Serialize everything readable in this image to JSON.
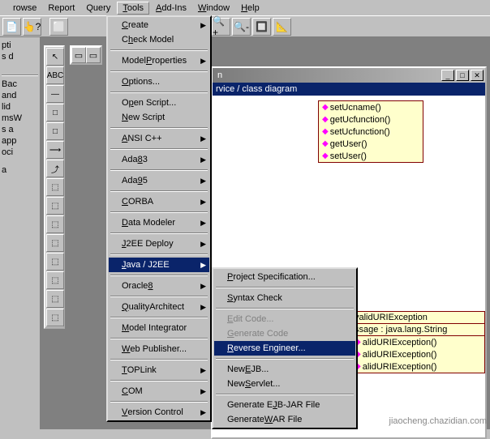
{
  "menubar": {
    "items": [
      "rowse",
      "Report",
      "Query",
      "Tools",
      "Add-Ins",
      "Window",
      "Help"
    ],
    "open_index": 3
  },
  "toolbar": {
    "buttons": [
      "📄",
      "👆?",
      "⬜",
      "|",
      "",
      "",
      "",
      "⊞",
      "🔍+",
      "🔍-",
      "🔲",
      "📐"
    ]
  },
  "palette": [
    "↖",
    "ABC",
    "—",
    "□",
    "□",
    "⟶",
    "⤴",
    "⬚",
    "⬚",
    "⬚",
    "⬚",
    "⬚",
    "⬚",
    "⬚",
    "⬚"
  ],
  "left_panel": [
    "pti",
    "s d",
    "",
    "",
    "Bac",
    "and",
    "lid",
    "msW",
    "s a",
    "app",
    "oci",
    "",
    "a"
  ],
  "child_window": {
    "title": "n",
    "selection_bar": "rvice / class diagram"
  },
  "class1": {
    "methods": [
      "setUcname()",
      "getUcfunction()",
      "setUcfunction()",
      "getUser()",
      "setUser()"
    ]
  },
  "class2": {
    "header": "validURIException",
    "attr": "ssage : java.lang.String",
    "methods": [
      "alidURIException()",
      "alidURIException()",
      "alidURIException()"
    ]
  },
  "tools_menu": {
    "items": [
      {
        "label": "Create",
        "accel": "C",
        "sub": true
      },
      {
        "label": "Check Model",
        "accel": "h"
      },
      {
        "sep": true
      },
      {
        "label": "Model Properties",
        "accel": "P",
        "sub": true
      },
      {
        "sep": true
      },
      {
        "label": "Options...",
        "accel": "O"
      },
      {
        "sep": true
      },
      {
        "label": "Open Script...",
        "accel": "p"
      },
      {
        "label": "New Script",
        "accel": "N"
      },
      {
        "sep": true
      },
      {
        "label": "ANSI C++",
        "accel": "A",
        "sub": true
      },
      {
        "sep": true
      },
      {
        "label": "Ada 83",
        "accel": "8",
        "sub": true
      },
      {
        "sep": true
      },
      {
        "label": "Ada 95",
        "accel": "9",
        "sub": true
      },
      {
        "sep": true
      },
      {
        "label": "CORBA",
        "accel": "C",
        "sub": true
      },
      {
        "sep": true
      },
      {
        "label": "Data Modeler",
        "accel": "D",
        "sub": true
      },
      {
        "sep": true
      },
      {
        "label": "J2EE Deploy",
        "accel": "J",
        "sub": true
      },
      {
        "sep": true
      },
      {
        "label": "Java / J2EE",
        "accel": "J",
        "sub": true,
        "sel": true
      },
      {
        "sep": true
      },
      {
        "label": "Oracle8",
        "accel": "8",
        "sub": true
      },
      {
        "sep": true
      },
      {
        "label": "QualityArchitect",
        "accel": "Q",
        "sub": true
      },
      {
        "sep": true
      },
      {
        "label": "Model Integrator",
        "accel": "M"
      },
      {
        "sep": true
      },
      {
        "label": "Web Publisher...",
        "accel": "W"
      },
      {
        "sep": true
      },
      {
        "label": "TOPLink",
        "accel": "T",
        "sub": true
      },
      {
        "sep": true
      },
      {
        "label": "COM",
        "accel": "C",
        "sub": true
      },
      {
        "sep": true
      },
      {
        "label": "Version Control",
        "accel": "V",
        "sub": true
      }
    ]
  },
  "java_submenu": {
    "items": [
      {
        "label": "Project Specification...",
        "accel": "P"
      },
      {
        "sep": true
      },
      {
        "label": "Syntax Check",
        "accel": "S"
      },
      {
        "sep": true
      },
      {
        "label": "Edit Code...",
        "accel": "E",
        "disabled": true
      },
      {
        "label": "Generate Code",
        "accel": "G",
        "disabled": true
      },
      {
        "label": "Reverse Engineer...",
        "accel": "R",
        "sel": true
      },
      {
        "sep": true
      },
      {
        "label": "New EJB...",
        "accel": "E"
      },
      {
        "label": "New Servlet...",
        "accel": "S"
      },
      {
        "sep": true
      },
      {
        "label": "Generate EJB-JAR File",
        "accel": "J"
      },
      {
        "label": "Generate WAR File",
        "accel": "W"
      }
    ]
  },
  "watermark": "jiaocheng.chazidian.com"
}
